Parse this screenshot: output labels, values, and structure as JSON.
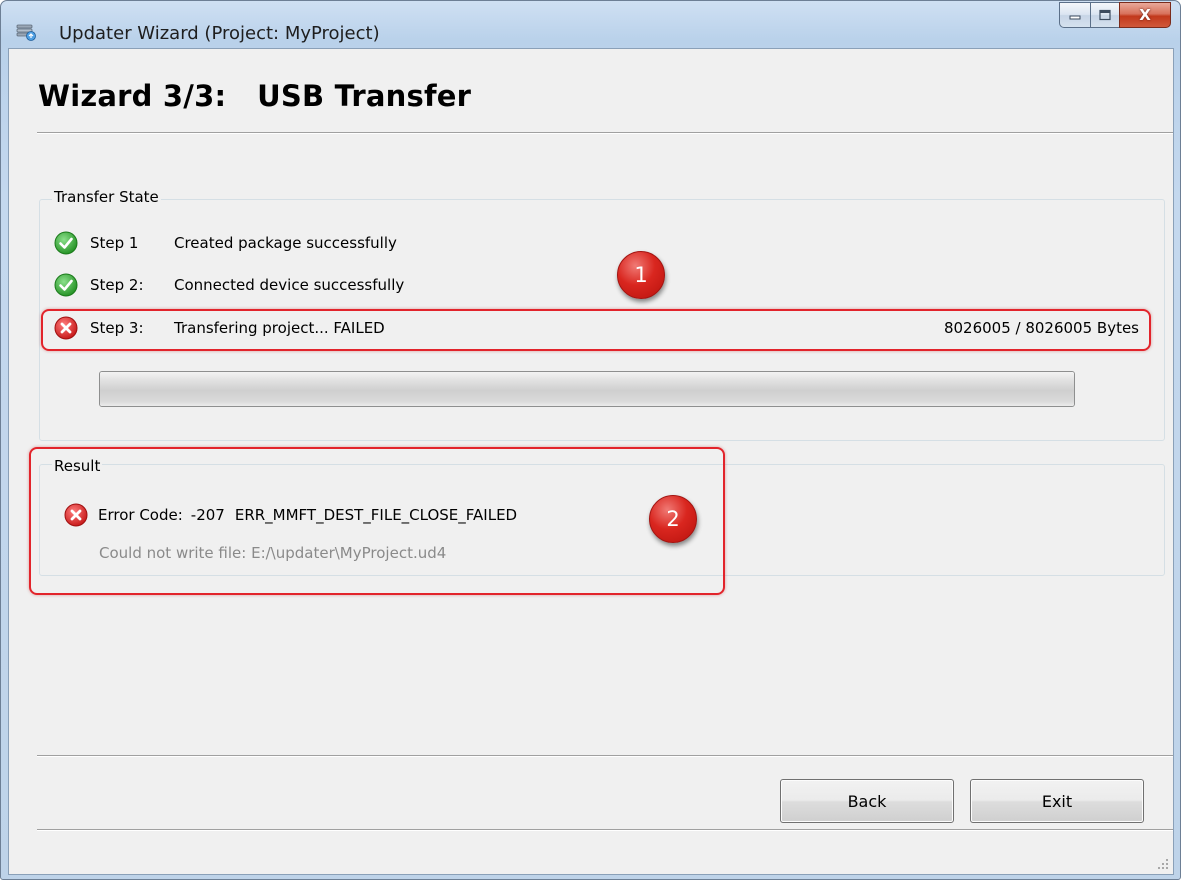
{
  "window": {
    "title": "Updater Wizard (Project: MyProject)",
    "close_glyph": "X"
  },
  "page": {
    "title": "Wizard 3/3:   USB Transfer"
  },
  "transfer_state": {
    "label": "Transfer State",
    "steps": [
      {
        "num": "Step 1",
        "text": "Created package successfully",
        "status": "success",
        "icon": "check-circle-icon"
      },
      {
        "num": "Step 2:",
        "text": "Connected device successfully",
        "status": "success",
        "icon": "check-circle-icon"
      },
      {
        "num": "Step 3:",
        "text": "Transfering project... FAILED",
        "status": "error",
        "icon": "error-circle-icon"
      }
    ],
    "bytes": "8026005 / 8026005 Bytes",
    "progress_fraction": 1.0
  },
  "result": {
    "label": "Result",
    "error_code_label": "Error Code:",
    "error_code": "-207",
    "error_name": "ERR_MMFT_DEST_FILE_CLOSE_FAILED",
    "detail": "Could not write file: E:/\\updater\\MyProject.ud4",
    "icon": "error-circle-icon"
  },
  "annotations": {
    "badge_1": "1",
    "badge_2": "2"
  },
  "buttons": {
    "back": "Back",
    "exit": "Exit"
  },
  "colors": {
    "success": "#2fa52f",
    "error": "#d42020",
    "annotation": "#e2242b"
  }
}
